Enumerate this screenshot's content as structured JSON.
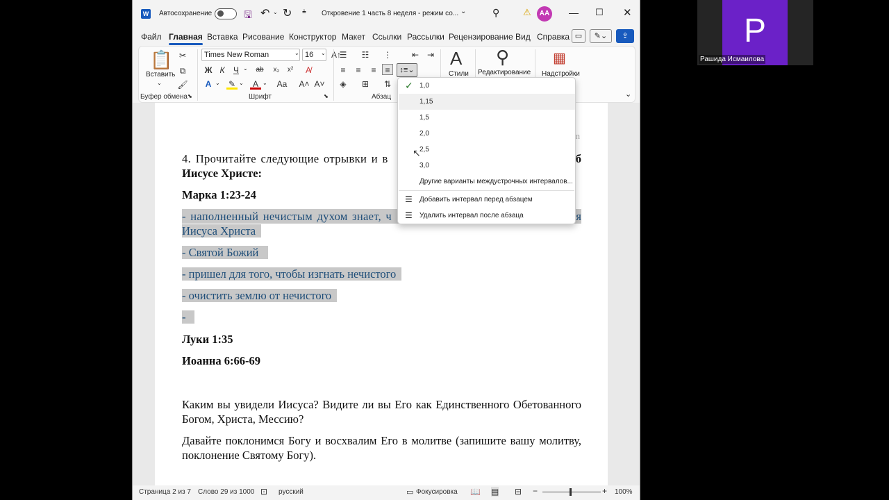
{
  "titlebar": {
    "autosave_label": "Автосохранение",
    "doc_title": "Откровение 1 часть 8 неделя  -  режим со...",
    "avatar_initials": "AA"
  },
  "menu": {
    "tabs": [
      "Файл",
      "Главная",
      "Вставка",
      "Рисование",
      "Конструктор",
      "Макет",
      "Ссылки",
      "Рассылки",
      "Рецензирование",
      "Вид",
      "Справка"
    ]
  },
  "ribbon": {
    "paste_label": "Вставить",
    "clipboard_group": "Буфер обмена",
    "font_name": "Times New Roman",
    "font_size": "16",
    "font_group": "Шрифт",
    "paragraph_group": "Абзац",
    "styles_label": "Стили",
    "editing_label": "Редактирование",
    "addins_label": "Надстройки",
    "bold": "Ж",
    "italic": "К",
    "underline": "Ч",
    "strike": "ab",
    "subscript": "x₂",
    "superscript": "x²",
    "font_color_letter": "A",
    "case_label": "Aa"
  },
  "document": {
    "watermark_fragment": "m",
    "q4_start": "4. Прочитайте следующие отрывки и в",
    "q4_end": "б",
    "q4_line2": "Иисусе Христе:",
    "mark_ref": "Марка 1:23-24",
    "hl_line1a": "- наполненный нечистым духом знает, ч",
    "hl_line1b": "я",
    "hl_line1c": "Иисуса Христа",
    "hl_line2": "- Святой Божий",
    "hl_line3": "- пришел для того, чтобы изгнать нечистого",
    "hl_line4": "- очистить землю от нечистого",
    "hl_line5": "-",
    "luke_ref": "Луки 1:35",
    "john_ref": "Иоанна 6:66-69",
    "para1": "Каким вы увидели Иисуса? Видите ли вы Его как Единственного Обетованного Богом, Христа, Мессию?",
    "para2": "Давайте поклонимся Богу и восхвалим Его в молитве (запишите вашу молитву, поклонение Святому Богу)."
  },
  "spacing_menu": {
    "options": [
      "1,0",
      "1,15",
      "1,5",
      "2,0",
      "2,5",
      "3,0"
    ],
    "selected": "1,0",
    "more": "Другие варианты междустрочных интервалов...",
    "add_before": "Добавить интервал перед абзацем",
    "remove_after": "Удалить интервал после абзаца"
  },
  "statusbar": {
    "page": "Страница 2 из 7",
    "words": "Слово 29 из 1000",
    "language": "русский",
    "focus": "Фокусировка",
    "zoom": "100%"
  },
  "participant": {
    "initial": "P",
    "name": "Рашида Исмаилова",
    "tile_color": "#6b21c8"
  },
  "colors": {
    "accent": "#185abd",
    "highlight_text": "#1f4e79",
    "highlight_bg": "#c8c8c8"
  }
}
